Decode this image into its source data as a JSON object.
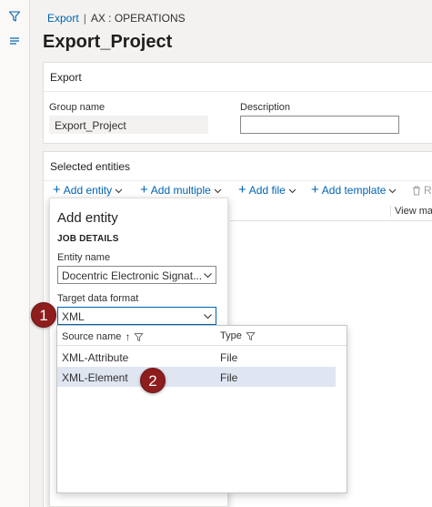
{
  "rail": {
    "icons": [
      "filter-icon",
      "list-icon"
    ]
  },
  "breadcrumb": {
    "link": "Export",
    "separator": "|",
    "company": "AX : OPERATIONS"
  },
  "page": {
    "title": "Export_Project"
  },
  "export_section": {
    "header": "Export",
    "group_name_label": "Group name",
    "group_name_value": "Export_Project",
    "description_label": "Description",
    "description_value": ""
  },
  "entities_section": {
    "header": "Selected entities",
    "toolbar": {
      "add_entity": "Add entity",
      "add_multiple": "Add multiple",
      "add_file": "Add file",
      "add_template": "Add template",
      "remove_partial": "R"
    },
    "grid_column_view": "View ma"
  },
  "flyout": {
    "title": "Add entity",
    "section": "JOB DETAILS",
    "entity_name_label": "Entity name",
    "entity_name_value": "Docentric Electronic Signat...",
    "target_format_label": "Target data format",
    "target_format_value": "XML"
  },
  "dropdown": {
    "columns": {
      "source_name": "Source name",
      "type": "Type",
      "sort_indicator": "↑"
    },
    "rows": [
      {
        "source_name": "XML-Attribute",
        "type": "File",
        "selected": false
      },
      {
        "source_name": "XML-Element",
        "type": "File",
        "selected": true
      }
    ]
  },
  "callouts": [
    "1",
    "2"
  ],
  "colors": {
    "link": "#0063b1",
    "badge": "#8e1d1d",
    "selected_row": "#dfe6f2"
  }
}
